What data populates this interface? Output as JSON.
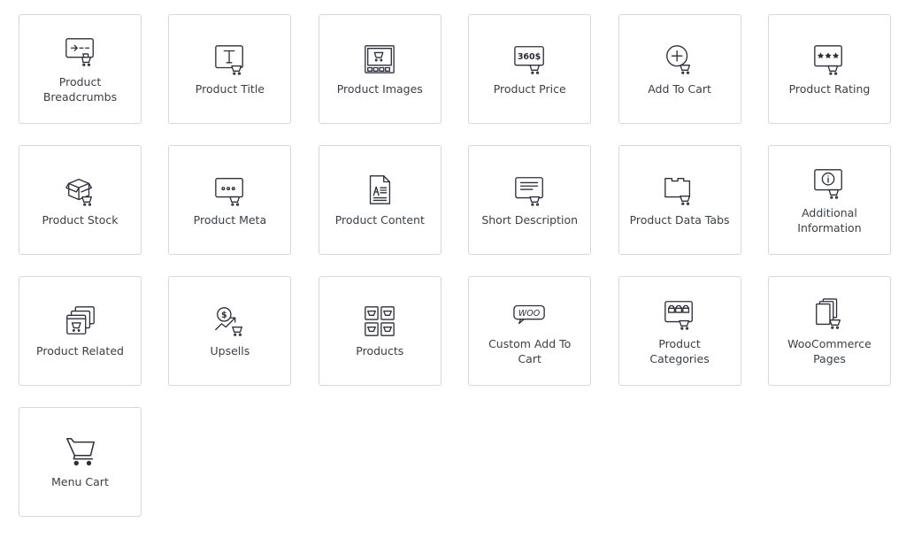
{
  "colors": {
    "icon_stroke": "#2d2f3a",
    "label": "#3a3f45",
    "card_border": "#d5d8dc",
    "background": "#ffffff"
  },
  "widgets": [
    {
      "label": "Product Breadcrumbs",
      "icon": "breadcrumbs-icon"
    },
    {
      "label": "Product Title",
      "icon": "title-icon"
    },
    {
      "label": "Product Images",
      "icon": "images-icon"
    },
    {
      "label": "Product Price",
      "icon": "price-icon",
      "icon_text": "360$"
    },
    {
      "label": "Add To Cart",
      "icon": "add-to-cart-icon"
    },
    {
      "label": "Product Rating",
      "icon": "rating-icon"
    },
    {
      "label": "Product Stock",
      "icon": "stock-icon"
    },
    {
      "label": "Product Meta",
      "icon": "meta-icon"
    },
    {
      "label": "Product Content",
      "icon": "content-icon"
    },
    {
      "label": "Short Description",
      "icon": "short-description-icon"
    },
    {
      "label": "Product Data Tabs",
      "icon": "data-tabs-icon"
    },
    {
      "label": "Additional Information",
      "icon": "info-icon"
    },
    {
      "label": "Product Related",
      "icon": "related-icon"
    },
    {
      "label": "Upsells",
      "icon": "upsells-icon"
    },
    {
      "label": "Products",
      "icon": "products-icon"
    },
    {
      "label": "Custom Add To Cart",
      "icon": "custom-add-to-cart-icon",
      "icon_text": "WOO"
    },
    {
      "label": "Product Categories",
      "icon": "categories-icon"
    },
    {
      "label": "WooCommerce Pages",
      "icon": "woocommerce-pages-icon"
    },
    {
      "label": "Menu Cart",
      "icon": "menu-cart-icon"
    }
  ]
}
